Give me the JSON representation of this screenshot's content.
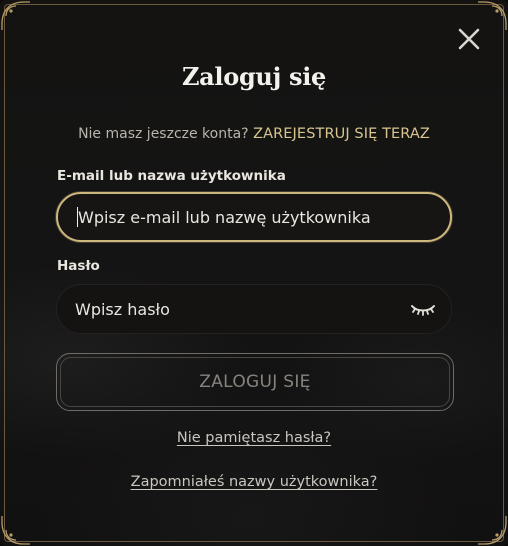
{
  "modal": {
    "title": "Zaloguj się",
    "signup_prompt": "Nie masz jeszcze konta?",
    "signup_link": "ZAREJESTRUJ SIĘ TERAZ"
  },
  "form": {
    "username_label": "E-mail lub nazwa użytkownika",
    "username_placeholder": "Wpisz e-mail lub nazwę użytkownika",
    "password_label": "Hasło",
    "password_placeholder": "Wpisz hasło",
    "submit_label": "ZALOGUJ SIĘ"
  },
  "links": {
    "forgot_password": "Nie pamiętasz hasła?",
    "forgot_username": "Zapomniałeś nazwy użytkownika?"
  },
  "icons": {
    "close": "close-icon",
    "password_toggle": "eye-closed-icon",
    "corner_ornament": "ornament-icon"
  },
  "colors": {
    "accent_gold": "#d8c58f",
    "input_focus_border": "#cdb77c",
    "background": "#141312",
    "disabled_text": "#86837d"
  }
}
